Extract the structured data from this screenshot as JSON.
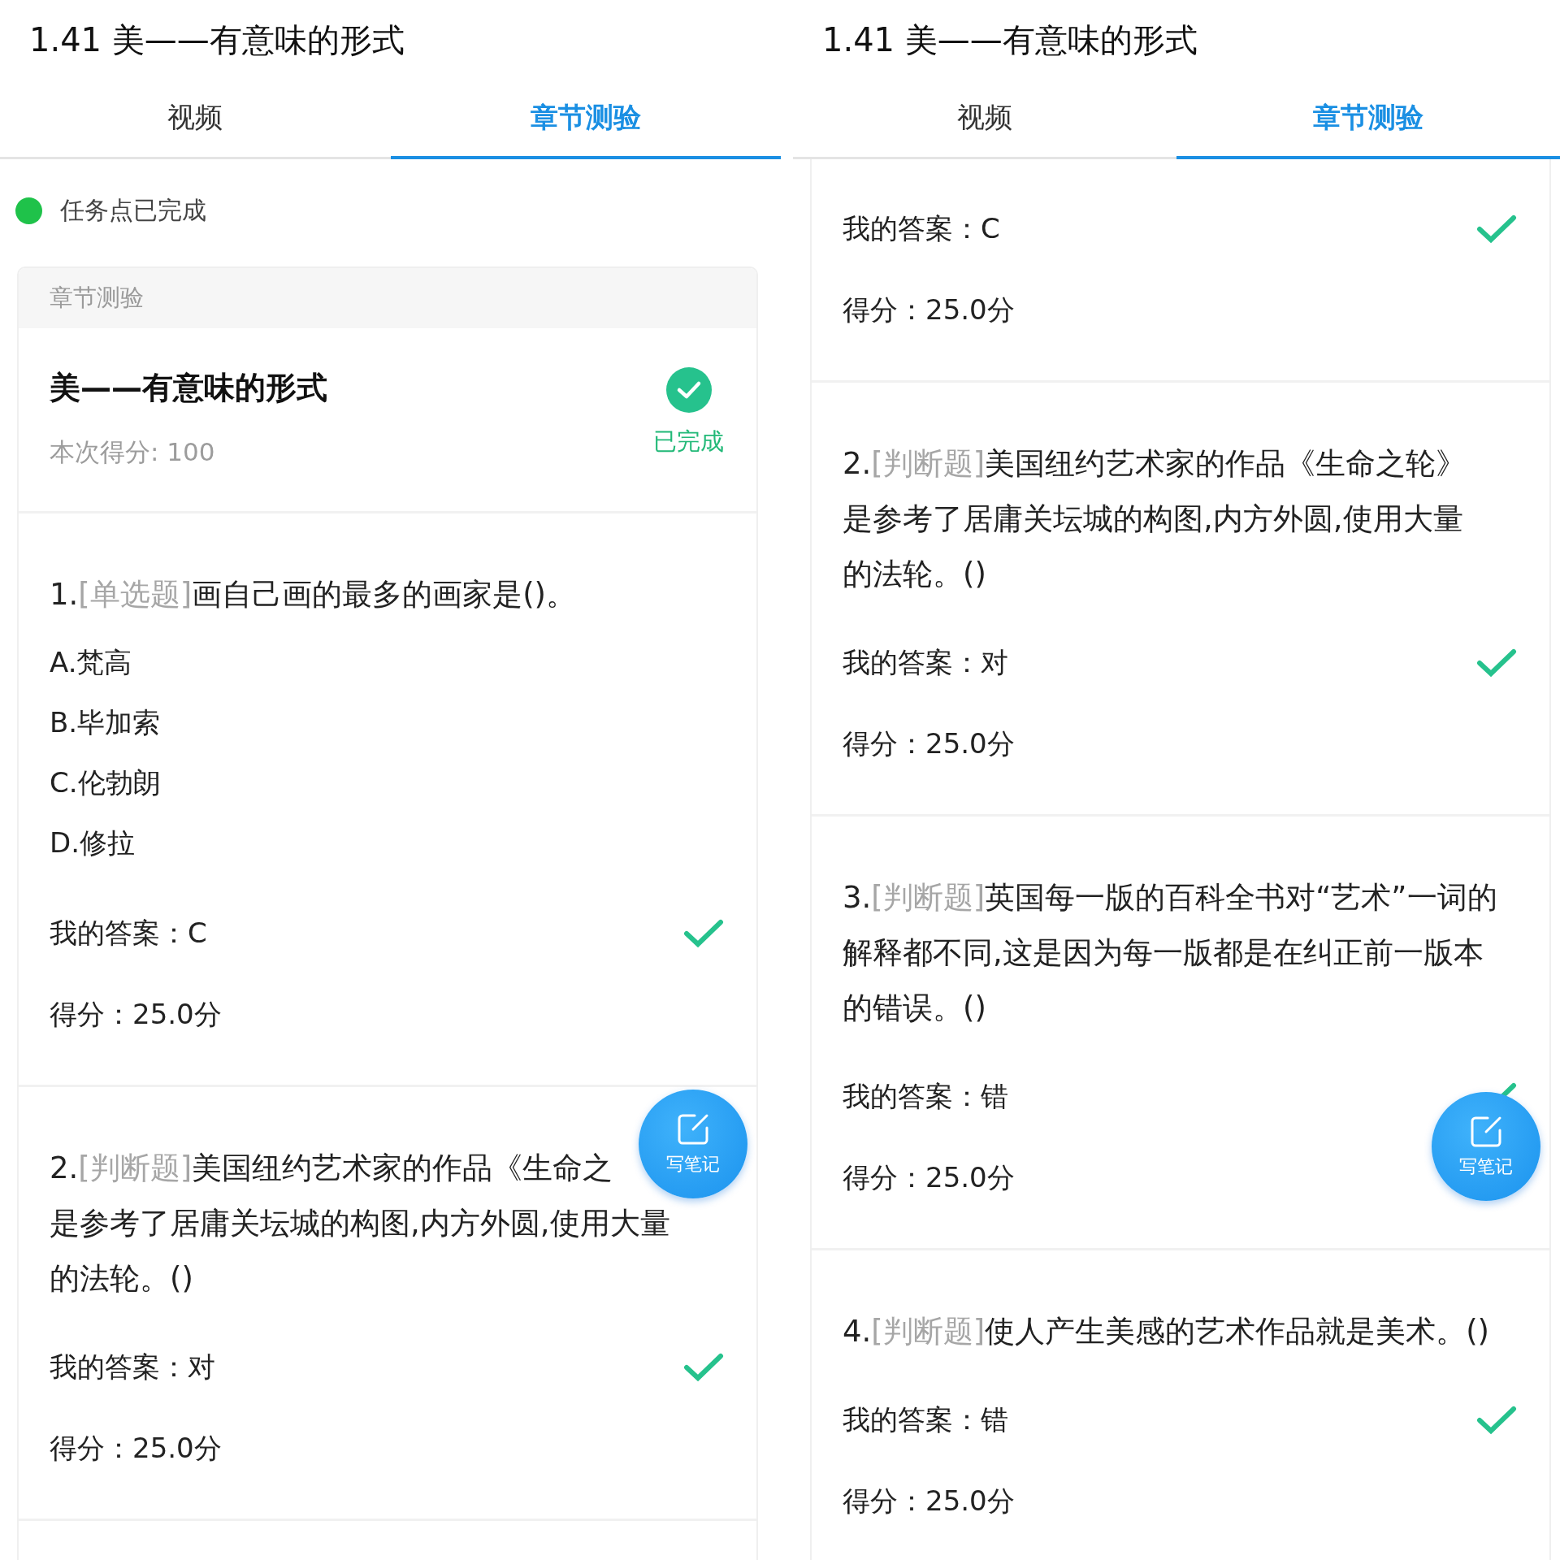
{
  "panels": [
    {
      "title": "1.41 美——有意味的形式",
      "tabs": [
        {
          "label": "视频",
          "selected": false
        },
        {
          "label": "章节测验",
          "selected": true
        }
      ],
      "status": {
        "text": "任务点已完成",
        "done": true
      },
      "card_header": "章节测验",
      "quiz": {
        "title": "美——有意味的形式",
        "score": "本次得分: 100",
        "badge": "已完成",
        "done": true
      },
      "questions": [
        {
          "number": "1.",
          "type": "[单选题]",
          "lines": [
            "画自己画的最多的画家是()。"
          ],
          "options": [
            "A.梵高",
            "B.毕加索",
            "C.伦勃朗",
            "D.修拉"
          ],
          "answer": "我的答案：C",
          "correct": true,
          "score": "得分：25.0分"
        },
        {
          "number": "2.",
          "type": "[判断题]",
          "lines": [
            "美国纽约艺术家的作品《生命之",
            "是参考了居庸关坛城的构图,内方外圆,使用大量",
            "的法轮。()"
          ],
          "answer": "我的答案：对",
          "correct": true,
          "score": "得分：25.0分"
        }
      ],
      "note_button": "写笔记"
    },
    {
      "title": "1.41 美——有意味的形式",
      "tabs": [
        {
          "label": "视频",
          "selected": false
        },
        {
          "label": "章节测验",
          "selected": true
        }
      ],
      "questions": [
        {
          "answer": "我的答案：C",
          "correct": true,
          "score": "得分：25.0分"
        },
        {
          "number": "2.",
          "type": "[判断题]",
          "lines": [
            "美国纽约艺术家的作品《生命之轮》",
            "是参考了居庸关坛城的构图,内方外圆,使用大量",
            "的法轮。()"
          ],
          "answer": "我的答案：对",
          "correct": true,
          "score": "得分：25.0分"
        },
        {
          "number": "3.",
          "type": "[判断题]",
          "lines": [
            "英国每一版的百科全书对“艺术”一词的",
            "解释都不同,这是因为每一版都是在纠正前一版本",
            "的错误。()"
          ],
          "answer": "我的答案：错",
          "correct": true,
          "score": "得分：25.0分"
        },
        {
          "number": "4.",
          "type": "[判断题]",
          "lines": [
            "使人产生美感的艺术作品就是美术。()"
          ],
          "answer": "我的答案：错",
          "correct": true,
          "score": "得分：25.0分"
        }
      ],
      "note_button": "写笔记"
    }
  ]
}
